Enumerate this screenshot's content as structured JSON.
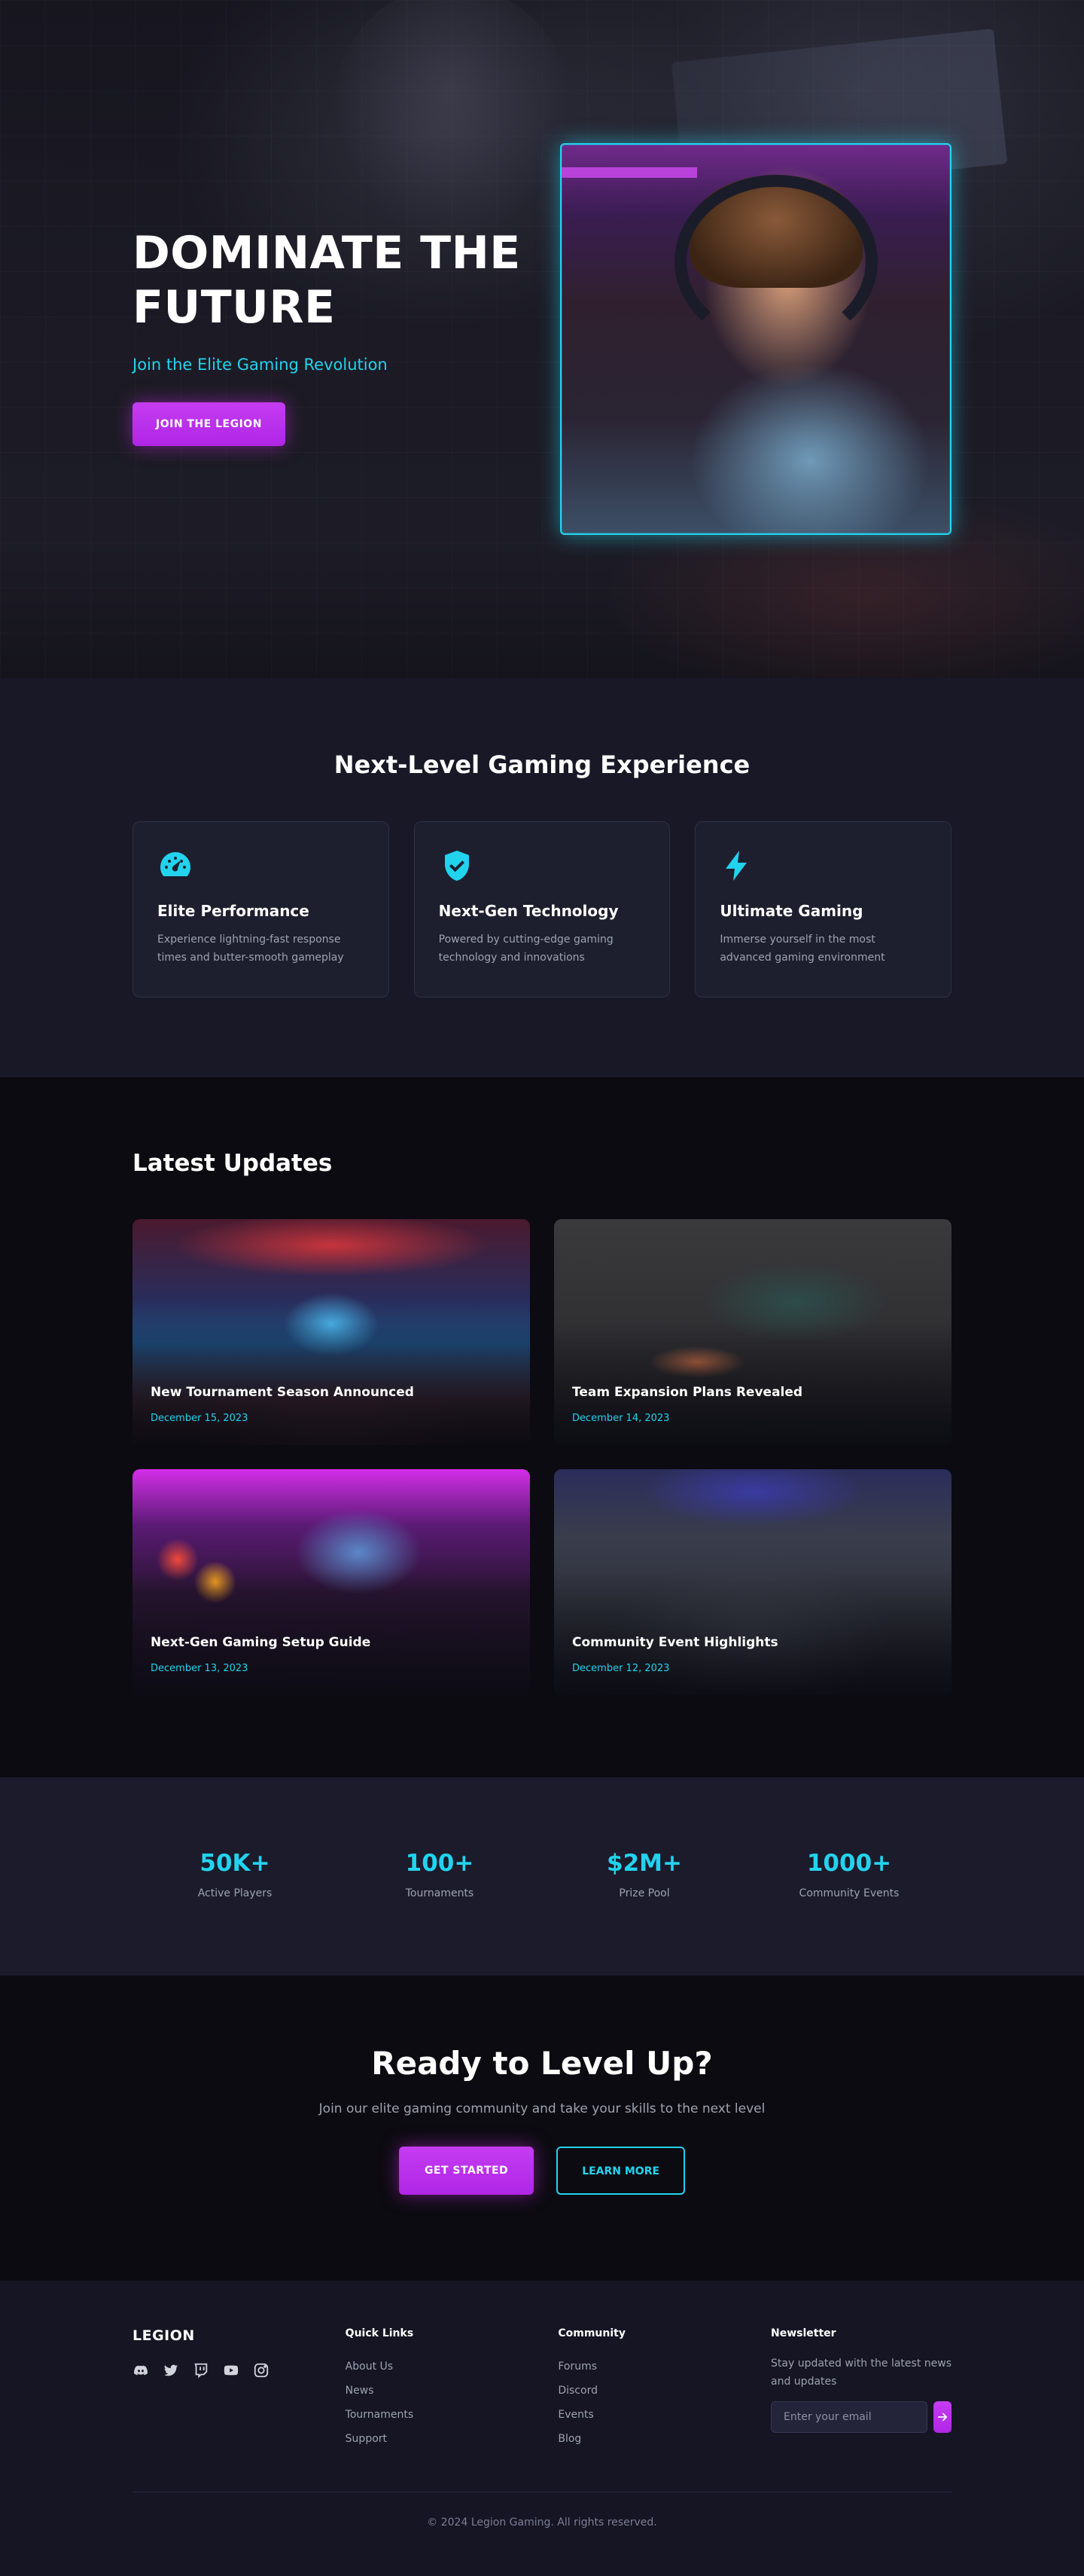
{
  "hero": {
    "title_line1": "DOMINATE THE",
    "title_line2": "FUTURE",
    "subtitle": "Join the Elite Gaming Revolution",
    "cta_label": "JOIN THE LEGION"
  },
  "features": {
    "title": "Next-Level Gaming Experience",
    "items": [
      {
        "icon": "speedometer-icon",
        "title": "Elite Performance",
        "desc": "Experience lightning-fast response times and butter-smooth gameplay"
      },
      {
        "icon": "shield-check-icon",
        "title": "Next-Gen Technology",
        "desc": "Powered by cutting-edge gaming technology and innovations"
      },
      {
        "icon": "lightning-bolt-icon",
        "title": "Ultimate Gaming",
        "desc": "Immerse yourself in the most advanced gaming environment"
      }
    ]
  },
  "updates": {
    "title": "Latest Updates",
    "items": [
      {
        "title": "New Tournament Season Announced",
        "date": "December 15, 2023"
      },
      {
        "title": "Team Expansion Plans Revealed",
        "date": "December 14, 2023"
      },
      {
        "title": "Next-Gen Gaming Setup Guide",
        "date": "December 13, 2023"
      },
      {
        "title": "Community Event Highlights",
        "date": "December 12, 2023"
      }
    ]
  },
  "stats": [
    {
      "value": "50K+",
      "label": "Active Players"
    },
    {
      "value": "100+",
      "label": "Tournaments"
    },
    {
      "value": "$2M+",
      "label": "Prize Pool"
    },
    {
      "value": "1000+",
      "label": "Community Events"
    }
  ],
  "cta": {
    "title": "Ready to Level Up?",
    "subtitle": "Join our elite gaming community and take your skills to the next level",
    "primary_label": "GET STARTED",
    "secondary_label": "LEARN MORE"
  },
  "footer": {
    "brand": "LEGION",
    "socials": [
      "discord-icon",
      "twitter-icon",
      "twitch-icon",
      "youtube-icon",
      "instagram-icon"
    ],
    "quick_links": {
      "title": "Quick Links",
      "items": [
        "About Us",
        "News",
        "Tournaments",
        "Support"
      ]
    },
    "community": {
      "title": "Community",
      "items": [
        "Forums",
        "Discord",
        "Events",
        "Blog"
      ]
    },
    "newsletter": {
      "title": "Newsletter",
      "text": "Stay updated with the latest news and updates",
      "placeholder": "Enter your email"
    },
    "copyright": "© 2024 Legion Gaming. All rights reserved."
  },
  "colors": {
    "accent_cyan": "#22d3ee",
    "accent_purple": "#c026d3",
    "background": "#0c0b11"
  }
}
